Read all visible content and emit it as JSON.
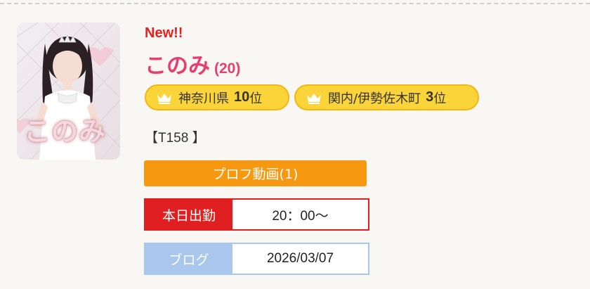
{
  "header": {
    "new_label": "New!!"
  },
  "profile": {
    "name": "このみ",
    "age": "(20)",
    "photo_caption": "このみ",
    "height": "【T158 】"
  },
  "rankings": [
    {
      "area": "神奈川県",
      "rank": "10",
      "suffix": "位",
      "icon": "crown-icon"
    },
    {
      "area": "関内/伊勢佐木町",
      "rank": "3",
      "suffix": "位",
      "icon": "crown-icon"
    }
  ],
  "buttons": {
    "profile_video": "プロフ動画(1)"
  },
  "schedule": {
    "label": "本日出勤",
    "value": "20：00〜"
  },
  "blog": {
    "label": "ブログ",
    "value": "2026/03/07"
  },
  "colors": {
    "background": "#f8f7f3",
    "new_red": "#e81f1f",
    "name_pink": "#e63e74",
    "badge_yellow": "#fbd43a",
    "video_orange": "#f79910",
    "schedule_red": "#e02020",
    "blog_blue": "#a9c6ec"
  }
}
